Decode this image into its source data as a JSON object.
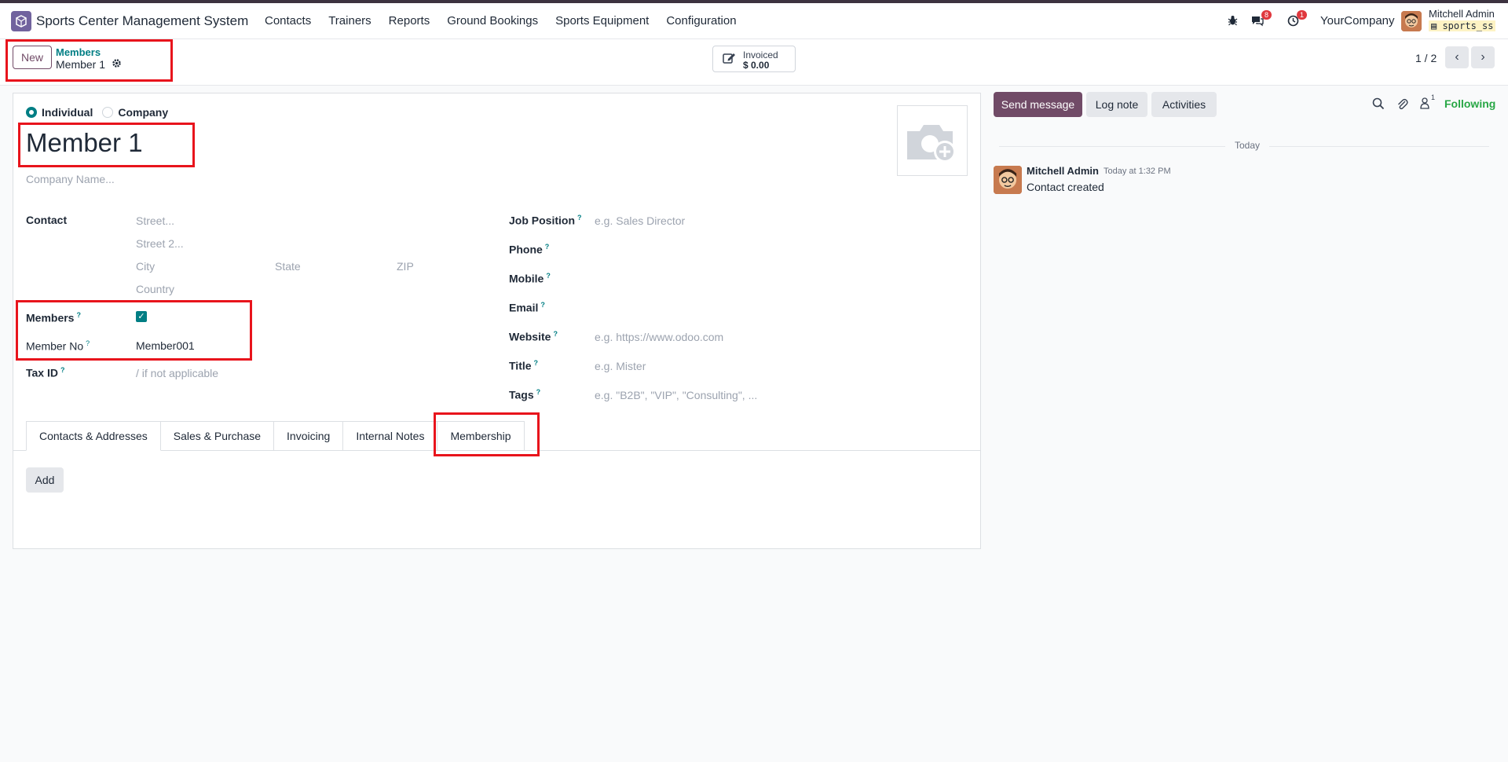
{
  "navbar": {
    "app_name": "Sports Center Management System",
    "menu": [
      "Contacts",
      "Trainers",
      "Reports",
      "Ground Bookings",
      "Sports Equipment",
      "Configuration"
    ],
    "messages_badge": "8",
    "activities_badge": "1",
    "company": "YourCompany",
    "user_name": "Mitchell Admin",
    "database": "sports_ss"
  },
  "control_panel": {
    "new_label": "New",
    "breadcrumb_parent": "Members",
    "breadcrumb_current": "Member 1",
    "stat_label": "Invoiced",
    "stat_value": "$ 0.00",
    "pager": "1 / 2"
  },
  "form": {
    "type_options": [
      "Individual",
      "Company"
    ],
    "selected_type": "Individual",
    "name": "Member 1",
    "company_name_placeholder": "Company Name...",
    "contact_label": "Contact",
    "street_placeholder": "Street...",
    "street2_placeholder": "Street 2...",
    "city_placeholder": "City",
    "state_placeholder": "State",
    "zip_placeholder": "ZIP",
    "country_placeholder": "Country",
    "members_label": "Members",
    "members_checked": true,
    "member_no_label": "Member No",
    "member_no_value": "Member001",
    "tax_id_label": "Tax ID",
    "tax_id_placeholder": "/ if not applicable",
    "job_position_label": "Job Position",
    "job_position_placeholder": "e.g. Sales Director",
    "phone_label": "Phone",
    "mobile_label": "Mobile",
    "email_label": "Email",
    "website_label": "Website",
    "website_placeholder": "e.g. https://www.odoo.com",
    "title_label": "Title",
    "title_placeholder": "e.g. Mister",
    "tags_label": "Tags",
    "tags_placeholder": "e.g. \"B2B\", \"VIP\", \"Consulting\", ...",
    "help_mark": "?"
  },
  "tabs": [
    "Contacts & Addresses",
    "Sales & Purchase",
    "Invoicing",
    "Internal Notes",
    "Membership"
  ],
  "add_label": "Add",
  "chatter": {
    "send_message": "Send message",
    "log_note": "Log note",
    "activities": "Activities",
    "followers_count": "1",
    "following": "Following",
    "date_separator": "Today",
    "author": "Mitchell Admin",
    "time": "Today at 1:32 PM",
    "body": "Contact created"
  },
  "colors": {
    "accent": "#714b67",
    "teal": "#017e84",
    "highlight": "#e8141c"
  }
}
